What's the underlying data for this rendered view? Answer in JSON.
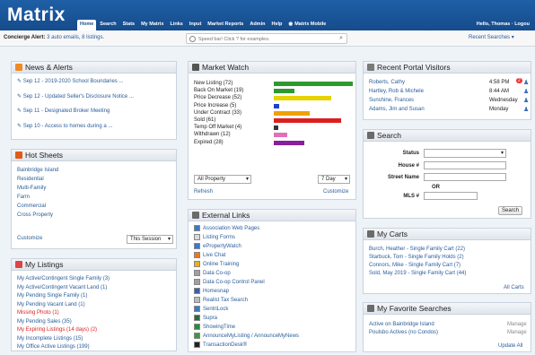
{
  "app": {
    "logo": "Matrix",
    "hello": "Hello, Thomas · Logou"
  },
  "nav": [
    "Home",
    "Search",
    "Stats",
    "My Matrix",
    "Links",
    "Input",
    "Market Reports",
    "Admin",
    "Help",
    "Matrix Mobile"
  ],
  "concierge": {
    "label": "Concierge Alert:",
    "text": "3 auto emails, 8 listings."
  },
  "speedbar": {
    "placeholder": "Speed bar! Click ? for examples."
  },
  "recent_searches": "Recent Searches",
  "news": {
    "title": "News & Alerts",
    "items": [
      "Sep 12 - 2019-2020 School Boundaries ...",
      "Sep 12 - Updated Seller's Disclosure Notice ...",
      "Sep 11 - Designated Broker Meeting",
      "Sep 10 - Access to homes during a ..."
    ]
  },
  "hotsheets": {
    "title": "Hot Sheets",
    "items": [
      "Bainbridge Island",
      "Residential",
      "Multi-Family",
      "Farm",
      "Commercial",
      "Cross Property"
    ],
    "customize": "Customize",
    "session": "This Session"
  },
  "listings": {
    "title": "My Listings",
    "items": [
      {
        "t": "My Active/Contingent Single Family (3)",
        "c": "#2a5d9a"
      },
      {
        "t": "My Active/Contingent Vacant Land (1)",
        "c": "#2a5d9a"
      },
      {
        "t": "My Pending Single Family (1)",
        "c": "#2a5d9a"
      },
      {
        "t": "My Pending Vacant Land (1)",
        "c": "#2a5d9a"
      },
      {
        "t": "Missing Photo (1)",
        "c": "#dd2222"
      },
      {
        "t": "My Pending Sales (35)",
        "c": "#2a5d9a"
      },
      {
        "t": "My Expiring Listings (14 days) (2)",
        "c": "#dd2222"
      },
      {
        "t": "My Incomplete Listings  (15)",
        "c": "#2a5d9a"
      },
      {
        "t": "My Office Active Listings (199)",
        "c": "#2a5d9a"
      }
    ]
  },
  "market": {
    "title": "Market Watch",
    "rows": [
      {
        "label": "New Listing (72)",
        "value": 72,
        "color": "#2e9a2e"
      },
      {
        "label": "Back On Market (19)",
        "value": 19,
        "color": "#2e9a2e"
      },
      {
        "label": "Price Decrease (52)",
        "value": 52,
        "color": "#e6d200"
      },
      {
        "label": "Price Increase (5)",
        "value": 5,
        "color": "#1f3fd0"
      },
      {
        "label": "Under Contract (33)",
        "value": 33,
        "color": "#f0a000"
      },
      {
        "label": "Sold (61)",
        "value": 61,
        "color": "#dd1e1e"
      },
      {
        "label": "Temp Off Market (4)",
        "value": 4,
        "color": "#333333"
      },
      {
        "label": "Withdrawn (12)",
        "value": 12,
        "color": "#e070b8"
      },
      {
        "label": "Expired (28)",
        "value": 28,
        "color": "#8a1ea0"
      }
    ],
    "property": "All Property",
    "days": "7 Day",
    "refresh": "Refresh",
    "customize": "Customize"
  },
  "external": {
    "title": "External Links",
    "items": [
      "Association Web Pages",
      "Listing Forms",
      "ePropertyWatch",
      "Live Chat",
      "Online Training",
      "Data Co-op",
      "Data Co-op Control Panel",
      "Homesnap",
      "Realist Tax Search",
      "SentriLock",
      "Supra",
      "ShowingTime",
      "AnnounceMyListing / AnnounceMyNews",
      "TransactionDesk®"
    ]
  },
  "visitors": {
    "title": "Recent Portal Visitors",
    "rows": [
      {
        "name": "Roberts, Cathy",
        "time": "4:58 PM"
      },
      {
        "name": "Hartley, Rob & Michele",
        "time": "8:44 AM"
      },
      {
        "name": "Sunshine, Frances",
        "time": "Wednesday"
      },
      {
        "name": "Adams, Jim and Susan",
        "time": "Monday"
      }
    ],
    "badge": "2"
  },
  "search": {
    "title": "Search",
    "status": "Status",
    "house": "House #",
    "street": "Street Name",
    "or": "OR",
    "mls": "MLS #",
    "button": "Search"
  },
  "carts": {
    "title": "My Carts",
    "items": [
      "Burch, Heather - Single Family Cart (22)",
      "Starbuck, Tom - Single Family Holds (2)",
      "Connors, Mike - Single Family Cart (7)",
      "Sold, May 2019 - Single Family Cart (44)"
    ],
    "all": "All Carts"
  },
  "favorites": {
    "title": "My Favorite Searches",
    "items": [
      "Active on Bainbridge Island",
      "Poulsbo Actives (no Condos)"
    ],
    "manage": "Manage",
    "update": "Update All"
  }
}
